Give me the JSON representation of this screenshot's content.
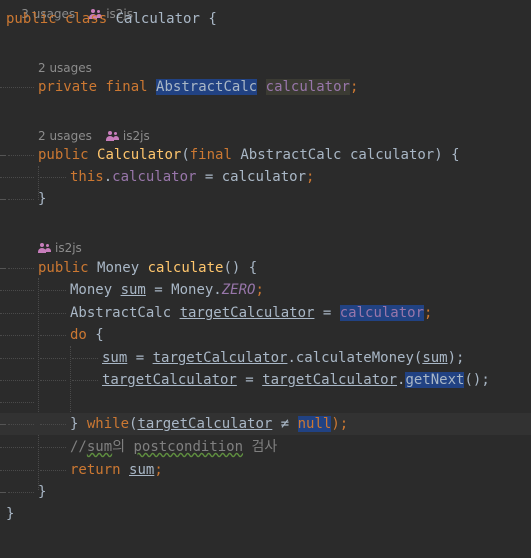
{
  "top_hint": {
    "usages": "3 usages",
    "author": "is2js"
  },
  "class_decl": {
    "kw_public": "public",
    "kw_class": "class",
    "name": "Calculator",
    "brace": "{"
  },
  "field": {
    "usages": "2 usages",
    "kw_private": "private",
    "kw_final": "final",
    "type": "AbstractCalc",
    "name": "calculator",
    "semi": ";"
  },
  "constructor": {
    "usages": "2 usages",
    "author": "is2js",
    "kw_public": "public",
    "name": "Calculator",
    "open": "(",
    "kw_final": "final",
    "param_type": "AbstractCalc",
    "param_name": "calculator",
    "close": ") {",
    "body_this": "this",
    "body_dot": ".",
    "body_field": "calculator",
    "body_assign": " = calculator",
    "body_semi": ";",
    "end": "}"
  },
  "method": {
    "author": "is2js",
    "kw_public": "public",
    "ret_type": "Money",
    "name": "calculate",
    "sig": "() {",
    "l1_type": "Money ",
    "l1_var": "sum",
    "l1_mid": " = Money.",
    "l1_const": "ZERO",
    "l1_semi": ";",
    "l2_type": "AbstractCalc ",
    "l2_var": "targetCalculator",
    "l2_mid": " = ",
    "l2_field": "calculator",
    "l2_semi": ";",
    "l3_do": "do",
    "l3_brace": " {",
    "l4_var": "sum",
    "l4_mid": " = ",
    "l4_target": "targetCalculator",
    "l4_call": ".calculateMoney(",
    "l4_arg": "sum",
    "l4_end": ");",
    "l5_var": "targetCalculator",
    "l5_mid": " = ",
    "l5_target": "targetCalculator",
    "l5_dot": ".",
    "l5_call": "getNext",
    "l5_end": "();",
    "l7_brace": "} ",
    "l7_while": "while",
    "l7_open": "(",
    "l7_var": "targetCalculator",
    "l7_op": " ≠ ",
    "l7_null": "null",
    "l7_end": ");",
    "l8_cmt_a": "//",
    "l8_cmt_sum": "sum",
    "l8_cmt_b": "의 ",
    "l8_cmt_post": "postcondition",
    "l8_cmt_c": " 검사",
    "l9_return": "return",
    "l9_var": "sum",
    "l9_semi": ";",
    "end": "}"
  },
  "class_end": "}"
}
